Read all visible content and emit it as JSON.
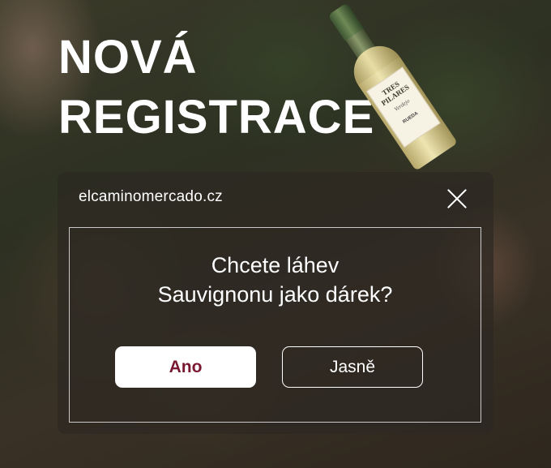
{
  "headline": {
    "line1": "NOVÁ",
    "line2": "REGISTRACE"
  },
  "bottle": {
    "brand": "TRES PILARES",
    "subtitle": "Verdejo",
    "region": "RUEDA",
    "icon": "wine-bottle-image"
  },
  "popup": {
    "site": "elcaminomercado.cz",
    "close_icon": "close-icon",
    "question_line1": "Chcete láhev",
    "question_line2": "Sauvignonu jako dárek?",
    "yes_label": "Ano",
    "ok_label": "Jasně"
  },
  "colors": {
    "overlay": "#2d2822",
    "yes_text": "#7a1832",
    "white": "#ffffff"
  }
}
